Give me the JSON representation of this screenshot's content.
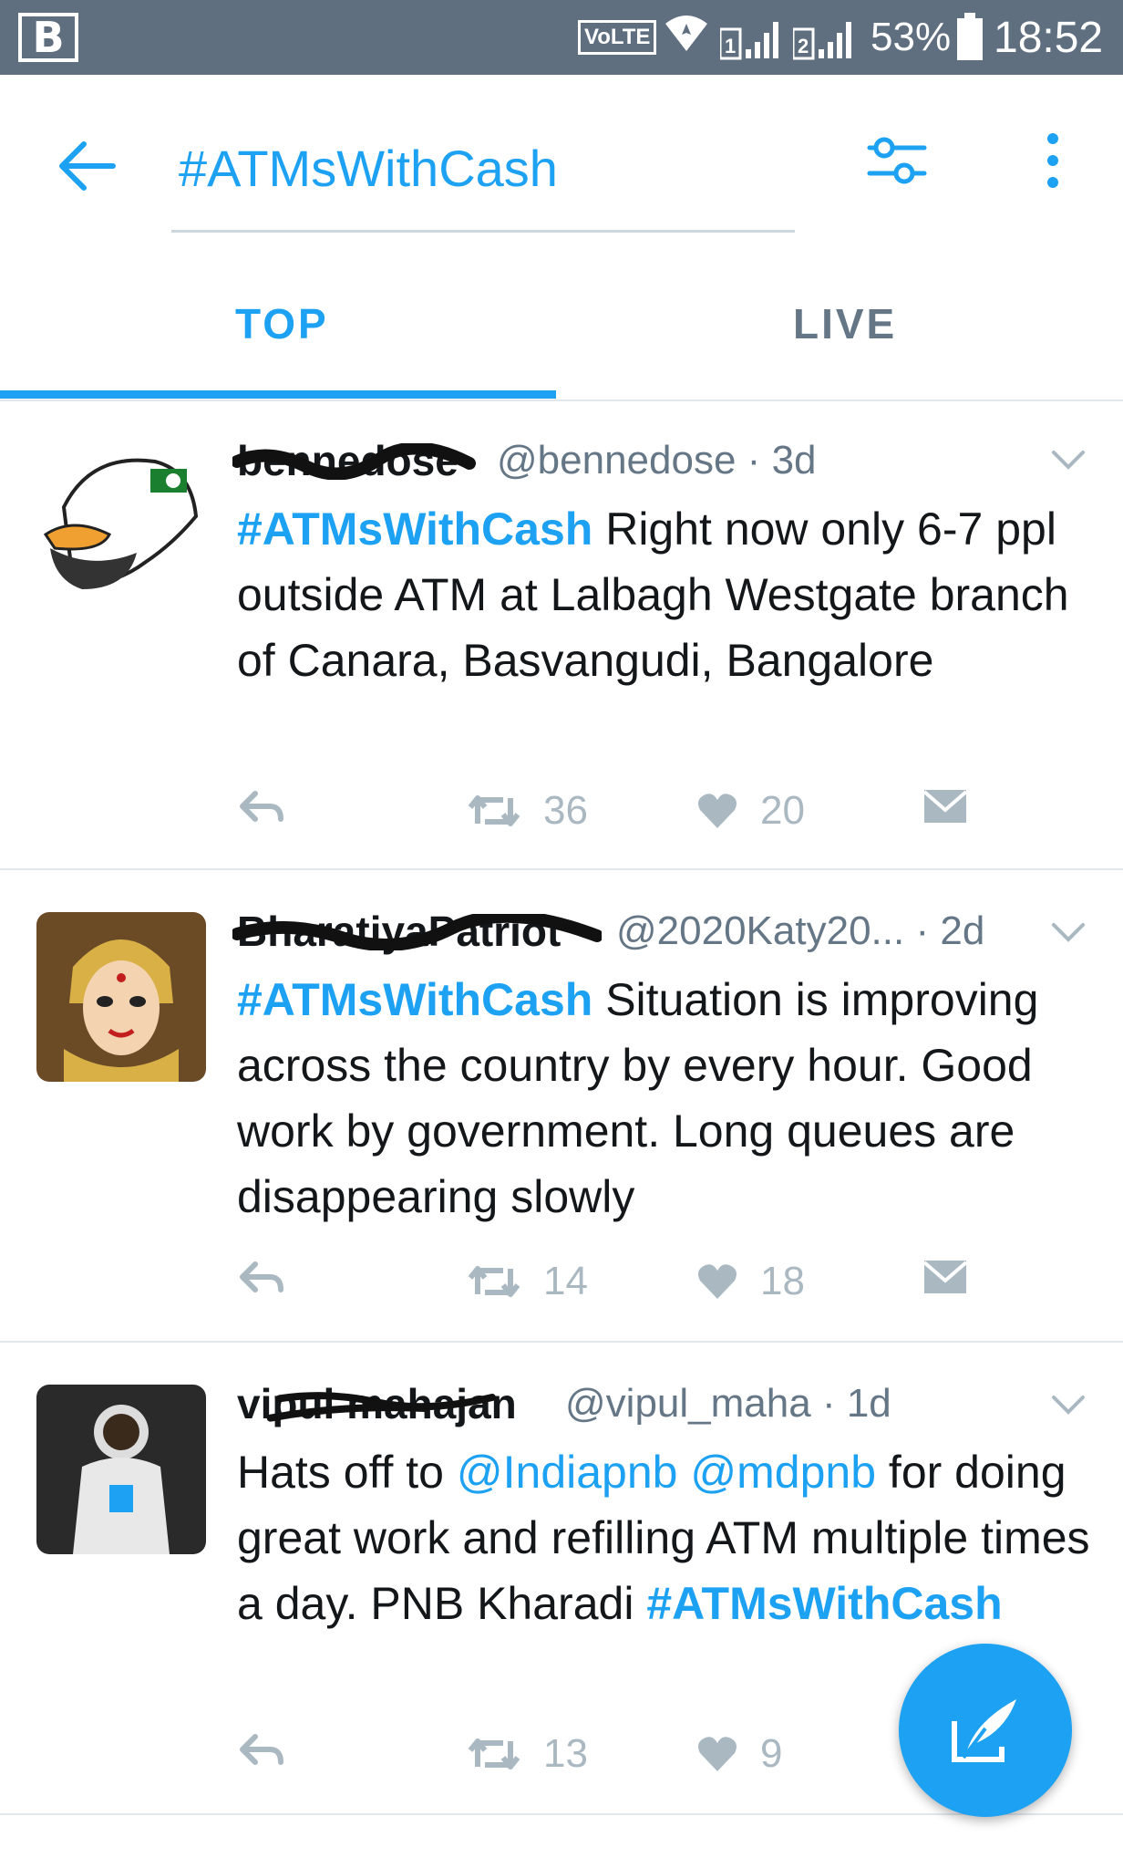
{
  "status_bar": {
    "app_letter": "B",
    "network": "VoLTE",
    "sim1": "1",
    "sim2": "2",
    "battery": "53%",
    "time": "18:52"
  },
  "search": {
    "query": "#ATMsWithCash"
  },
  "tabs": [
    {
      "label": "TOP",
      "active": true
    },
    {
      "label": "LIVE",
      "active": false
    }
  ],
  "tweets": [
    {
      "name": "bennedose",
      "handle": "@bennedose",
      "time": "3d",
      "body_parts": [
        {
          "type": "hashtag",
          "text": "#ATMsWithCash"
        },
        {
          "type": "text",
          "text": " Right now only 6-7 ppl outside ATM at Lalbagh Westgate branch of Canara, Basvangudi, Bangalore"
        }
      ],
      "retweets": "36",
      "likes": "20"
    },
    {
      "name": "BharatiyaPatriot",
      "handle": "@2020Katy20...",
      "time": "2d",
      "body_parts": [
        {
          "type": "hashtag",
          "text": "#ATMsWithCash"
        },
        {
          "type": "text",
          "text": " Situation is improving across the country by every hour. Good work by government. Long queues are disappearing slowly"
        }
      ],
      "retweets": "14",
      "likes": "18"
    },
    {
      "name": "vipul mahajan",
      "handle": "@vipul_maha",
      "time": "1d",
      "body_parts": [
        {
          "type": "text",
          "text": "Hats off to "
        },
        {
          "type": "mention",
          "text": "@Indiapnb"
        },
        {
          "type": "text",
          "text": " "
        },
        {
          "type": "mention",
          "text": "@mdpnb"
        },
        {
          "type": "text",
          "text": " for doing great work and refilling ATM multiple times a day. PNB Kharadi "
        },
        {
          "type": "hashtag",
          "text": "#ATMsWithCash"
        }
      ],
      "retweets": "13",
      "likes": "9"
    }
  ],
  "colors": {
    "accent": "#1da1f2",
    "status_bar": "#5f6f80",
    "muted": "#aab8c2"
  }
}
